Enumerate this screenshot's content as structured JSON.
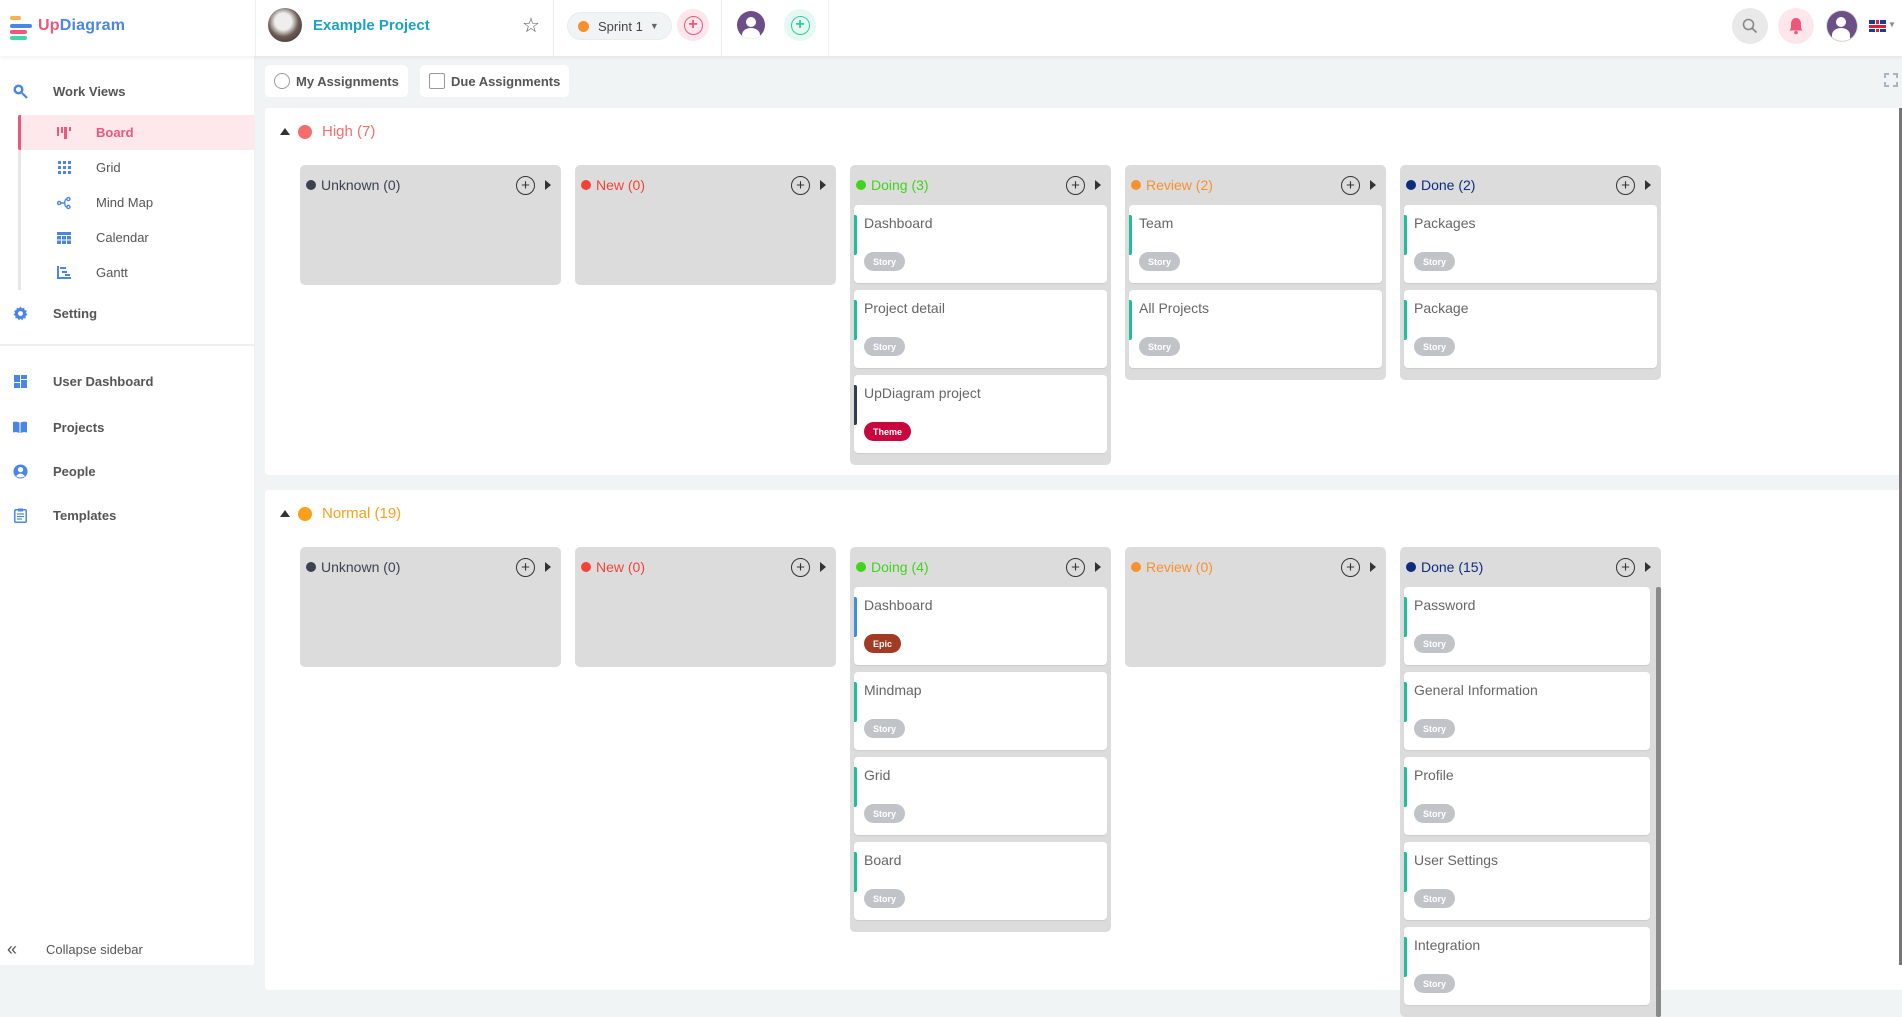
{
  "header": {
    "logo": {
      "prefix": "Up",
      "suffix": "Diagram"
    },
    "project_name": "Example Project",
    "sprint": {
      "label": "Sprint 1",
      "color": "#f9902e"
    },
    "icons": [
      "star-icon",
      "add-sprint-icon",
      "user-avatar-icon",
      "add-member-icon",
      "search-icon",
      "bell-icon",
      "account-avatar-icon",
      "uk-flag-icon"
    ]
  },
  "sidebar": {
    "work_views": "Work Views",
    "views": [
      {
        "label": "Board",
        "icon": "board-icon",
        "active": true
      },
      {
        "label": "Grid",
        "icon": "grid-icon"
      },
      {
        "label": "Mind Map",
        "icon": "mindmap-icon"
      },
      {
        "label": "Calendar",
        "icon": "calendar-icon"
      },
      {
        "label": "Gantt",
        "icon": "gantt-icon"
      }
    ],
    "setting": "Setting",
    "items": [
      {
        "label": "User Dashboard",
        "icon": "dashboard-icon"
      },
      {
        "label": "Projects",
        "icon": "book-icon"
      },
      {
        "label": "People",
        "icon": "person-icon"
      },
      {
        "label": "Templates",
        "icon": "clipboard-icon"
      }
    ],
    "collapse": "Collapse sidebar"
  },
  "toolbar": {
    "my_assignments": "My Assignments",
    "due_assignments": "Due Assignments"
  },
  "colors": {
    "unknown": "#3d4252",
    "new": "#f44336",
    "doing": "#3fd51b",
    "review": "#f9902e",
    "done": "#0c2d7e",
    "story_tag": "#c0c4c8",
    "theme_tag": "#c8073f",
    "epic_tag": "#a33a24",
    "bar_teal": "#1fbf9b",
    "bar_blue": "#3f8fe0",
    "bar_dark": "#2e3f55",
    "high": "#f66d6d",
    "normal": "#f9a11b"
  },
  "sections": [
    {
      "label": "High (7)",
      "color": "#f66d6d",
      "columns": [
        {
          "label": "Unknown (0)",
          "status": "unknown",
          "cards": []
        },
        {
          "label": "New (0)",
          "status": "new",
          "cards": []
        },
        {
          "label": "Doing (3)",
          "status": "doing",
          "cards": [
            {
              "title": "Dashboard",
              "tag": "Story",
              "bar": "teal"
            },
            {
              "title": "Project detail",
              "tag": "Story",
              "bar": "teal"
            },
            {
              "title": "UpDiagram project",
              "tag": "Theme",
              "bar": "dark"
            }
          ]
        },
        {
          "label": "Review (2)",
          "status": "review",
          "cards": [
            {
              "title": "Team",
              "tag": "Story",
              "bar": "teal"
            },
            {
              "title": "All Projects",
              "tag": "Story",
              "bar": "teal"
            }
          ]
        },
        {
          "label": "Done (2)",
          "status": "done",
          "cards": [
            {
              "title": "Packages",
              "tag": "Story",
              "bar": "teal"
            },
            {
              "title": "Package",
              "tag": "Story",
              "bar": "teal"
            }
          ]
        }
      ]
    },
    {
      "label": "Normal (19)",
      "color": "#f9a11b",
      "columns": [
        {
          "label": "Unknown (0)",
          "status": "unknown",
          "cards": []
        },
        {
          "label": "New (0)",
          "status": "new",
          "cards": []
        },
        {
          "label": "Doing (4)",
          "status": "doing",
          "cards": [
            {
              "title": "Dashboard",
              "tag": "Epic",
              "bar": "blue"
            },
            {
              "title": "Mindmap",
              "tag": "Story",
              "bar": "teal"
            },
            {
              "title": "Grid",
              "tag": "Story",
              "bar": "teal"
            },
            {
              "title": "Board",
              "tag": "Story",
              "bar": "teal"
            }
          ]
        },
        {
          "label": "Review (0)",
          "status": "review",
          "cards": []
        },
        {
          "label": "Done (15)",
          "status": "done",
          "scroll": true,
          "cards": [
            {
              "title": "Password",
              "tag": "Story",
              "bar": "teal"
            },
            {
              "title": "General Information",
              "tag": "Story",
              "bar": "teal"
            },
            {
              "title": "Profile",
              "tag": "Story",
              "bar": "teal"
            },
            {
              "title": "User Settings",
              "tag": "Story",
              "bar": "teal"
            },
            {
              "title": "Integration",
              "tag": "Story",
              "bar": "teal"
            }
          ]
        }
      ]
    }
  ]
}
